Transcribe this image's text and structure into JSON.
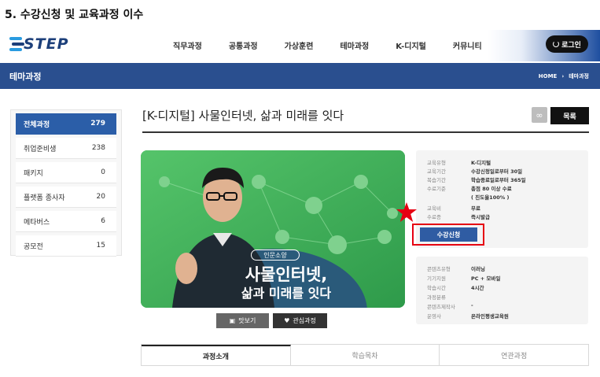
{
  "doc_heading": "5. 수강신청 및 교육과정 이수",
  "logo": {
    "text": "STEP"
  },
  "nav": {
    "items": [
      "직무과정",
      "공통과정",
      "가상훈련",
      "테마과정",
      "K-디지털",
      "커뮤니티"
    ],
    "login": "로그인"
  },
  "banner": {
    "title": "테마과정",
    "breadcrumb": [
      "HOME",
      "테마과정"
    ]
  },
  "sidebar": {
    "items": [
      {
        "label": "전체과정",
        "count": "279",
        "active": true
      },
      {
        "label": "취업준비생",
        "count": "238"
      },
      {
        "label": "패키지",
        "count": "0"
      },
      {
        "label": "플랫폼 종사자",
        "count": "20"
      },
      {
        "label": "메타버스",
        "count": "6"
      },
      {
        "label": "공모전",
        "count": "15"
      }
    ]
  },
  "course": {
    "title": "[K-디지털] 사물인터넷, 삶과 미래를 잇다",
    "list_button": "목록",
    "thumbnail": {
      "tag": "인문소양",
      "line1": "사물인터넷,",
      "line2": "삶과 미래를 잇다"
    },
    "preview_button": "맛보기",
    "wish_button": "관심과정",
    "enroll_button": "수강신청"
  },
  "info1": [
    {
      "label": "교육유형",
      "value": "K-디지털"
    },
    {
      "label": "교육기간",
      "value": "수강신청일로부터 30일"
    },
    {
      "label": "복습기간",
      "value": "학습종료일로부터 365일"
    },
    {
      "label": "수료기준",
      "value": "총점 80 이상 수료"
    },
    {
      "label": "",
      "value": "( 진도율100% )"
    },
    {
      "label": "교육비",
      "value": "무료"
    },
    {
      "label": "수료증",
      "value": "즉시발급"
    }
  ],
  "info2": [
    {
      "label": "콘텐츠유형",
      "value": "이러닝"
    },
    {
      "label": "기기지원",
      "value": "PC + 모바일"
    },
    {
      "label": "학습시간",
      "value": "4시간"
    },
    {
      "label": "과정분류",
      "value": ""
    },
    {
      "label": "콘텐츠제작사",
      "value": "-"
    },
    {
      "label": "운영사",
      "value": "온라인평생교육원"
    }
  ],
  "tabs": [
    "과정소개",
    "학습목차",
    "연관과정"
  ],
  "colors": {
    "brand": "#2a4f8f",
    "accent": "#2f5ca3",
    "highlight": "#e60012",
    "thumb_bg": "#3fae57"
  }
}
